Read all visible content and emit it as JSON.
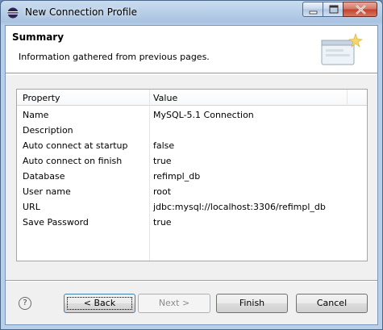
{
  "window": {
    "title": "New Connection Profile"
  },
  "header": {
    "title": "Summary",
    "description": "Information gathered from previous pages."
  },
  "table": {
    "columns": [
      "Property",
      "Value"
    ],
    "rows": [
      {
        "property": "Name",
        "value": "MySQL-5.1 Connection"
      },
      {
        "property": "Description",
        "value": ""
      },
      {
        "property": "Auto connect at startup",
        "value": "false"
      },
      {
        "property": "Auto connect on finish",
        "value": "true"
      },
      {
        "property": "Database",
        "value": "refimpl_db"
      },
      {
        "property": "User name",
        "value": "root"
      },
      {
        "property": "URL",
        "value": "jdbc:mysql://localhost:3306/refimpl_db"
      },
      {
        "property": "Save Password",
        "value": "true"
      }
    ]
  },
  "buttons": {
    "help": "?",
    "back": "< Back",
    "back_mnemonic": "B",
    "next": "Next >",
    "finish": "Finish",
    "cancel": "Cancel"
  },
  "icons": {
    "app": "eclipse-icon",
    "minimize": "minimize-icon",
    "maximize": "maximize-icon",
    "close": "close-icon",
    "banner": "wizard-banner-icon",
    "help": "help-icon"
  }
}
